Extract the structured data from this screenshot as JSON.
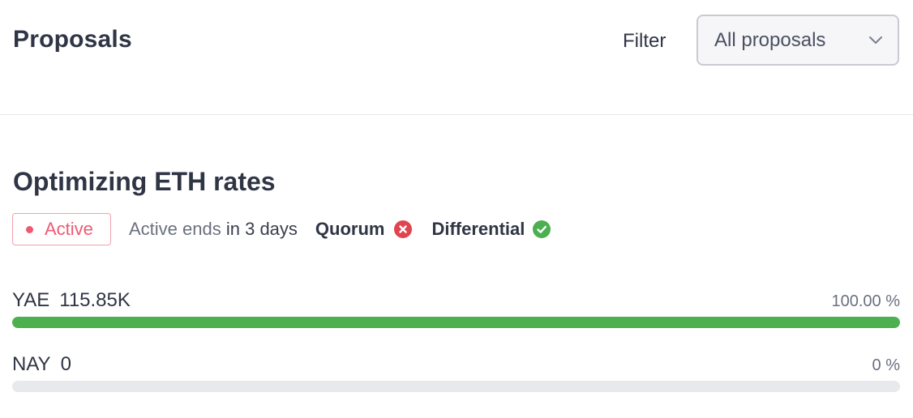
{
  "header": {
    "title": "Proposals",
    "filter_label": "Filter",
    "filter_value": "All proposals"
  },
  "proposal": {
    "title": "Optimizing ETH rates",
    "status": "Active",
    "ends_prefix": "Active ends",
    "ends_value": "in 3 days",
    "quorum_label": "Quorum",
    "quorum_icon": "x-circle-icon",
    "differential_label": "Differential",
    "differential_icon": "check-circle-icon",
    "colors": {
      "active": "#ef5a72",
      "quorum_fail": "#e0454f",
      "differential_pass": "#4caf50",
      "bar_fill": "#4caf50",
      "bar_track": "#e8e9ec"
    }
  },
  "votes": [
    {
      "label": "YAE",
      "amount": "115.85K",
      "percent_text": "100.00 %",
      "fraction": 1.0
    },
    {
      "label": "NAY",
      "amount": "0",
      "percent_text": "0 %",
      "fraction": 0.0
    }
  ]
}
